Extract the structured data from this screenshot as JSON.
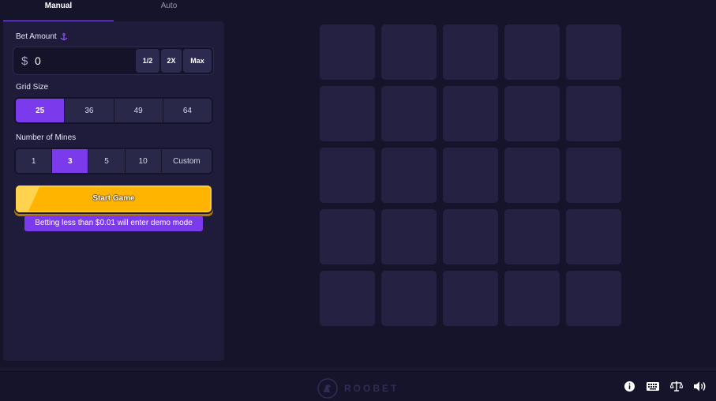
{
  "tabs": [
    {
      "label": "Manual",
      "active": true
    },
    {
      "label": "Auto",
      "active": false
    }
  ],
  "bet": {
    "label": "Bet Amount",
    "currency_symbol": "$",
    "value": "0",
    "half_label": "1/2",
    "double_label": "2X",
    "max_label": "Max"
  },
  "grid_size": {
    "label": "Grid Size",
    "options": [
      "25",
      "36",
      "49",
      "64"
    ],
    "selected": "25"
  },
  "mines": {
    "label": "Number of Mines",
    "options": [
      "1",
      "3",
      "5",
      "10",
      "Custom"
    ],
    "selected": "3"
  },
  "start_button": "Start Game",
  "demo_note": "Betting less than $0.01 will enter demo mode",
  "board": {
    "rows": 5,
    "cols": 5
  },
  "footer": {
    "logo_text": "ROOBET",
    "icons": [
      "info-icon",
      "keyboard-icon",
      "balance-scale-icon",
      "volume-icon"
    ]
  },
  "colors": {
    "background": "#16142b",
    "panel": "#1e1c3a",
    "accent": "#7c3aed",
    "start_button": "#ffb400",
    "tile": "#242143"
  }
}
